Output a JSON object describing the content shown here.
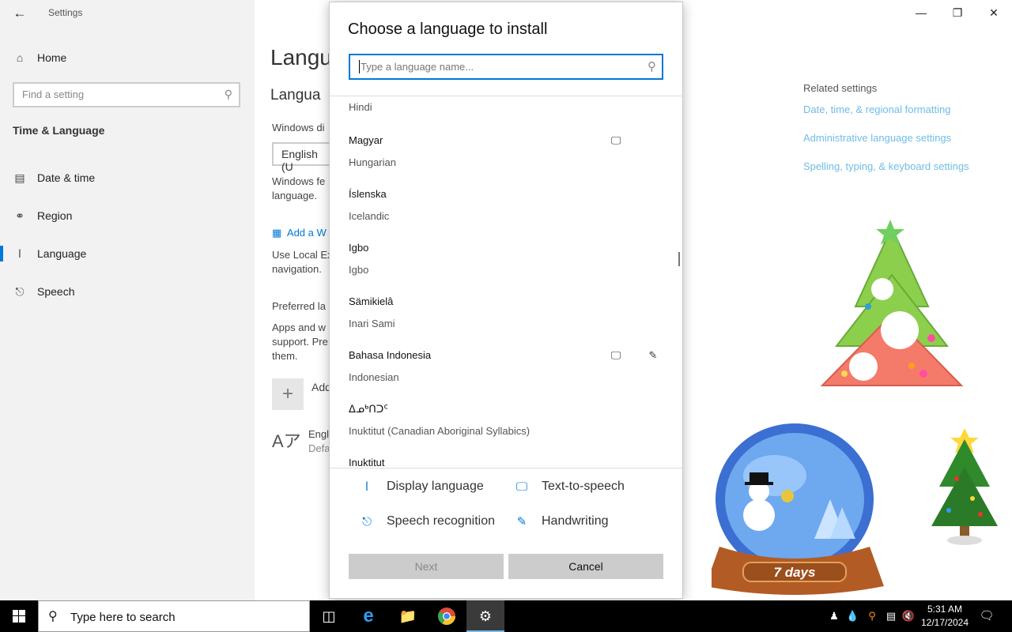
{
  "settings": {
    "app_title": "Settings",
    "nav": {
      "home": "Home",
      "find_placeholder": "Find a setting",
      "section_title": "Time & Language",
      "items": [
        {
          "label": "Date & time",
          "icon": "calendar-clock-icon"
        },
        {
          "label": "Region",
          "icon": "globe-icon"
        },
        {
          "label": "Language",
          "icon": "language-icon"
        },
        {
          "label": "Speech",
          "icon": "microphone-icon"
        }
      ]
    },
    "main": {
      "heading": "Langu",
      "subheading": "Langua",
      "windows_display_label": "Windows di",
      "display_select_value": "English (U",
      "windows_features_text": [
        "Windows fe",
        "language."
      ],
      "add_windows_link": "Add a W",
      "local_experience_text": [
        "Use Local Ex",
        "navigation."
      ],
      "preferred_label": "Preferred la",
      "apps_text": [
        "Apps and w",
        "support. Pre",
        "them."
      ],
      "add_label": "Add",
      "english_label": "Engl",
      "default_label": "Defa"
    },
    "related": {
      "title": "Related settings",
      "links": [
        "Date, time, & regional formatting",
        "Administrative language settings",
        "Spelling, typing, & keyboard settings"
      ]
    }
  },
  "dialog": {
    "title": "Choose a language to install",
    "search_placeholder": "Type a language name...",
    "languages": [
      {
        "native": "",
        "english": "Hindi",
        "display": false,
        "handwriting": false
      },
      {
        "native": "Magyar",
        "english": "Hungarian",
        "display": true,
        "handwriting": false
      },
      {
        "native": "Íslenska",
        "english": "Icelandic",
        "display": false,
        "handwriting": false
      },
      {
        "native": "Igbo",
        "english": "Igbo",
        "display": false,
        "handwriting": false
      },
      {
        "native": "Sämikielâ",
        "english": "Inari Sami",
        "display": false,
        "handwriting": false
      },
      {
        "native": "Bahasa Indonesia",
        "english": "Indonesian",
        "display": true,
        "handwriting": true
      },
      {
        "native": "ᐃᓄᒃᑎᑐᑦ",
        "english": "Inuktitut (Canadian Aboriginal Syllabics)",
        "display": false,
        "handwriting": false
      },
      {
        "native": "Inuktitut",
        "english": "",
        "display": false,
        "handwriting": false
      }
    ],
    "features": {
      "display_language": "Display language",
      "text_to_speech": "Text-to-speech",
      "speech_recognition": "Speech recognition",
      "handwriting": "Handwriting"
    },
    "buttons": {
      "next": "Next",
      "cancel": "Cancel"
    }
  },
  "decorations": {
    "globe_label": "7 days"
  },
  "taskbar": {
    "search_placeholder": "Type here to search",
    "time": "5:31 AM",
    "date": "12/17/2024"
  },
  "colors": {
    "accent": "#0078d7",
    "link_light": "#6fbde6",
    "sidebar_bg": "#f2f2f2"
  }
}
